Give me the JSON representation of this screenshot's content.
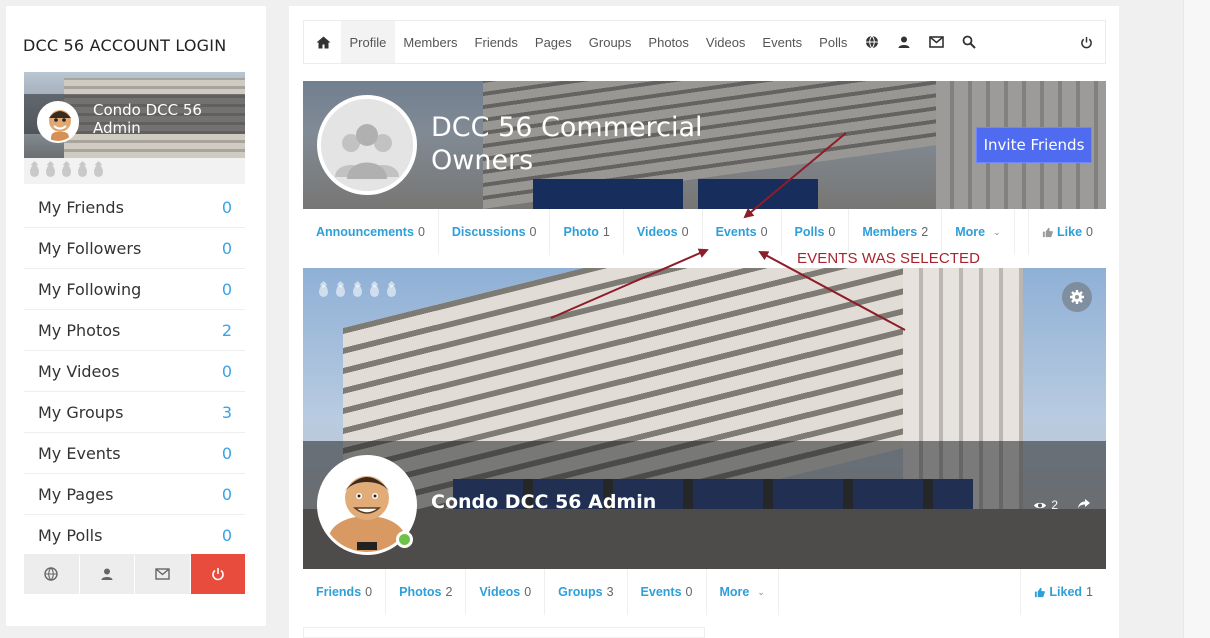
{
  "sidebar": {
    "title": "DCC 56 ACCOUNT LOGIN",
    "user_name": "Condo DCC 56 Admin",
    "items": [
      {
        "label": "My Friends",
        "count": "0"
      },
      {
        "label": "My Followers",
        "count": "0"
      },
      {
        "label": "My Following",
        "count": "0"
      },
      {
        "label": "My Photos",
        "count": "2"
      },
      {
        "label": "My Videos",
        "count": "0"
      },
      {
        "label": "My Groups",
        "count": "3"
      },
      {
        "label": "My Events",
        "count": "0"
      },
      {
        "label": "My Pages",
        "count": "0"
      },
      {
        "label": "My Polls",
        "count": "0"
      }
    ],
    "icons": [
      "globe-icon",
      "user-icon",
      "mail-icon",
      "power-icon"
    ]
  },
  "topnav": {
    "items": [
      "Profile",
      "Members",
      "Friends",
      "Pages",
      "Groups",
      "Photos",
      "Videos",
      "Events",
      "Polls"
    ],
    "active": "Profile",
    "icons": [
      "home-icon",
      "globe-icon",
      "user-icon",
      "mail-icon",
      "search-icon",
      "power-icon"
    ]
  },
  "group": {
    "title": "DCC 56 Commercial Owners",
    "invite_label": "Invite Friends",
    "tabs": [
      {
        "label": "Announcements",
        "count": "0"
      },
      {
        "label": "Discussions",
        "count": "0"
      },
      {
        "label": "Photo",
        "count": "1"
      },
      {
        "label": "Videos",
        "count": "0"
      },
      {
        "label": "Events",
        "count": "0"
      },
      {
        "label": "Polls",
        "count": "0"
      },
      {
        "label": "Members",
        "count": "2"
      }
    ],
    "more_label": "More",
    "like": {
      "label": "Like",
      "count": "0"
    }
  },
  "profile": {
    "name": "Condo DCC 56 Admin",
    "views": "2",
    "tabs": [
      {
        "label": "Friends",
        "count": "0"
      },
      {
        "label": "Photos",
        "count": "2"
      },
      {
        "label": "Videos",
        "count": "0"
      },
      {
        "label": "Groups",
        "count": "3"
      },
      {
        "label": "Events",
        "count": "0"
      }
    ],
    "more_label": "More",
    "liked": {
      "label": "Liked",
      "count": "1"
    }
  },
  "annotation": {
    "text": "EVENTS WAS SELECTED",
    "color": "#a8232f"
  },
  "colors": {
    "accent_blue": "#2d9fd9",
    "invite_button": "#4f6bf0",
    "power_button": "#e74c3c",
    "online": "#6cc24a"
  }
}
